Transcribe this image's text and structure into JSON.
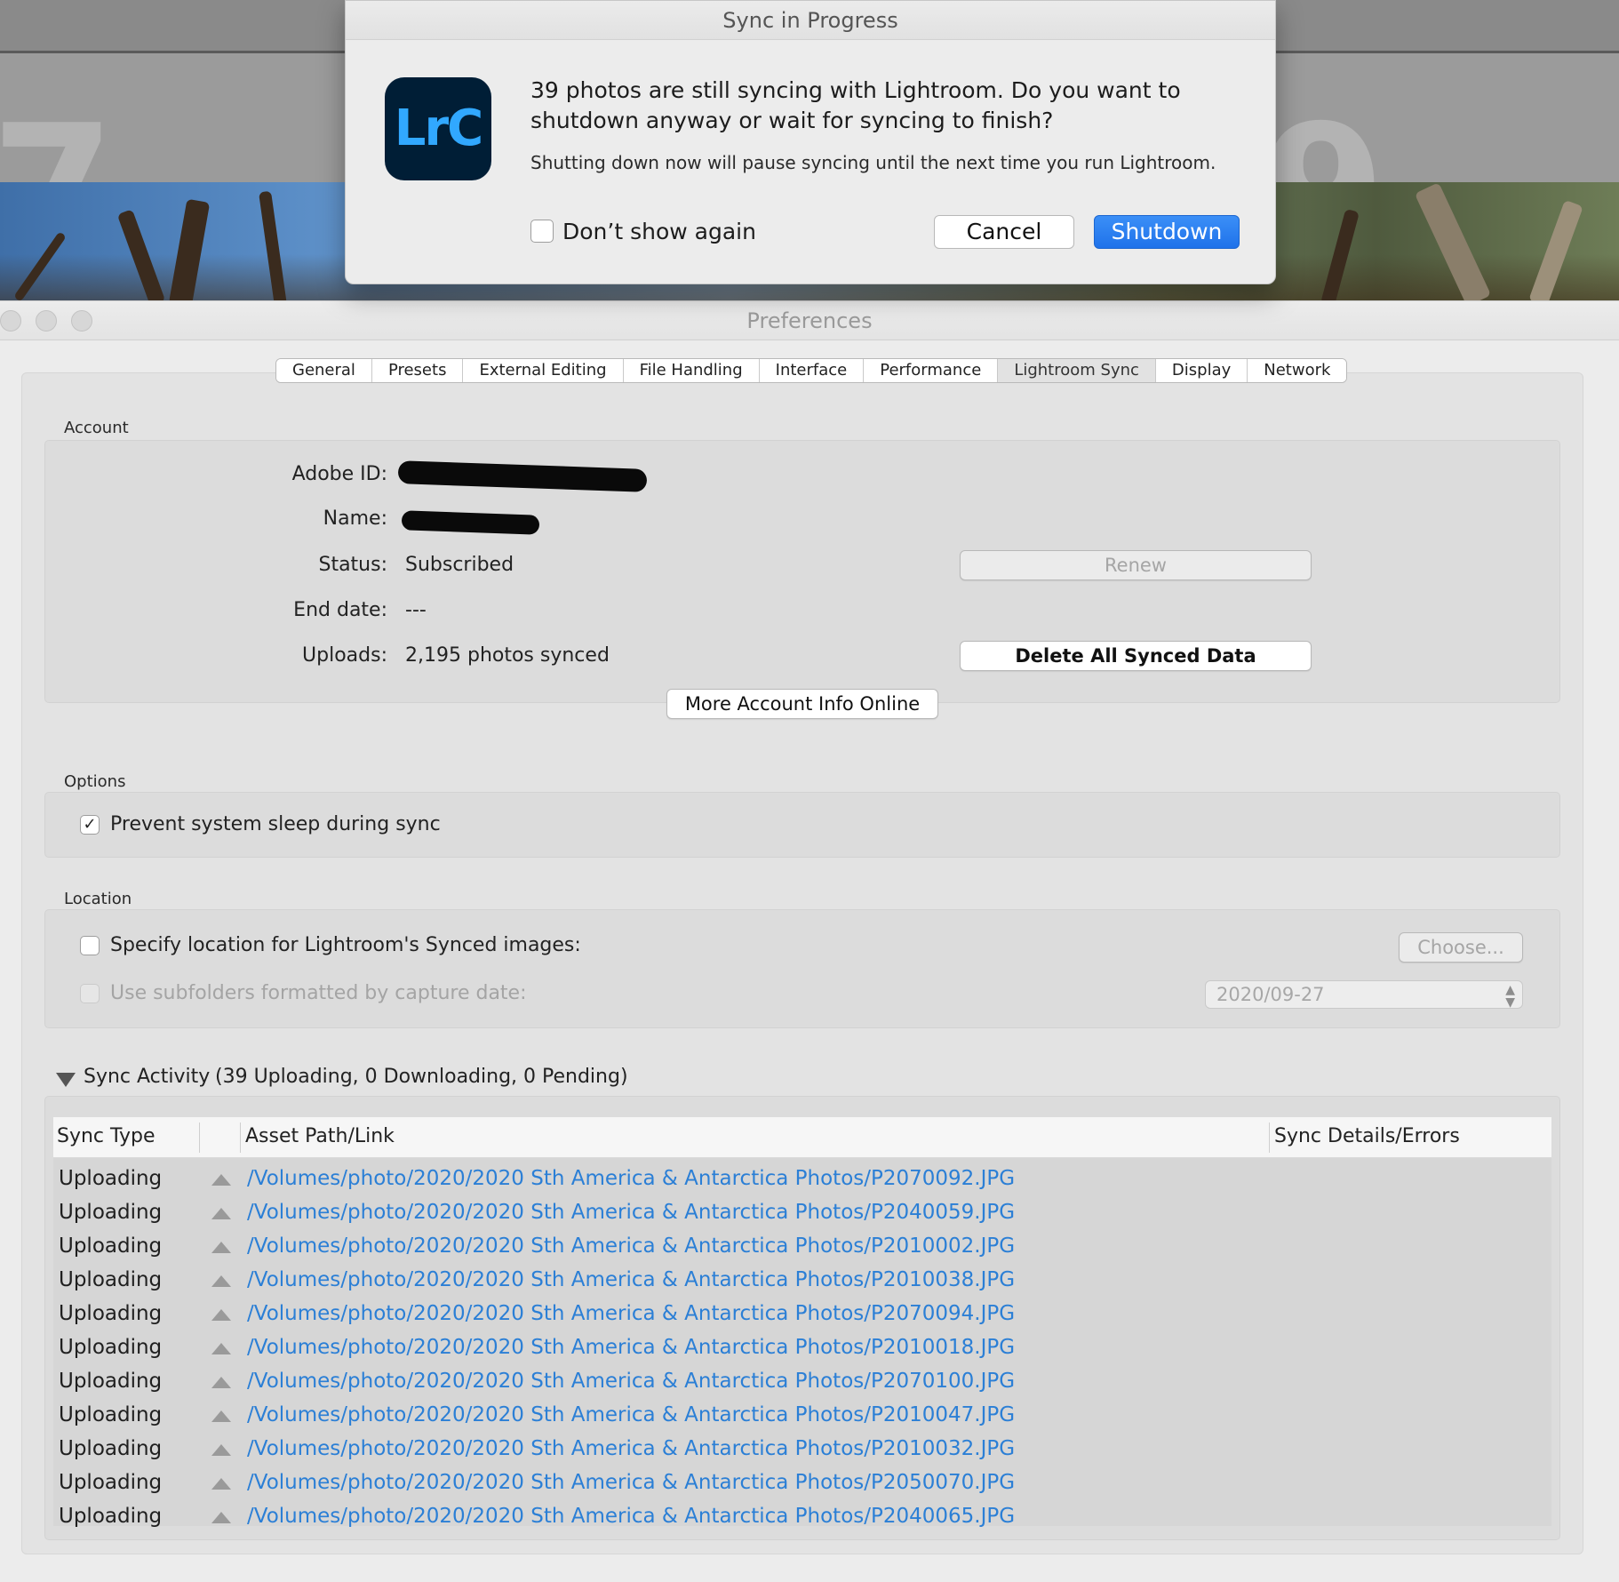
{
  "dialog": {
    "title": "Sync in Progress",
    "app_icon_text": "LrC",
    "message": "39 photos are still syncing with Lightroom. Do you want to shutdown anyway or wait for syncing to finish?",
    "submessage": "Shutting down now will pause syncing until the next time you run Lightroom.",
    "dont_show_label": "Don’t show again",
    "cancel_label": "Cancel",
    "shutdown_label": "Shutdown"
  },
  "window": {
    "title": "Preferences"
  },
  "tabs": [
    "General",
    "Presets",
    "External Editing",
    "File Handling",
    "Interface",
    "Performance",
    "Lightroom Sync",
    "Display",
    "Network"
  ],
  "active_tab": "Lightroom Sync",
  "account": {
    "section_label": "Account",
    "adobe_id_label": "Adobe ID:",
    "name_label": "Name:",
    "status_label": "Status:",
    "status_value": "Subscribed",
    "end_date_label": "End date:",
    "end_date_value": "---",
    "uploads_label": "Uploads:",
    "uploads_value": "2,195 photos synced",
    "renew_label": "Renew",
    "delete_label": "Delete All Synced Data",
    "more_info_label": "More Account Info Online"
  },
  "options": {
    "section_label": "Options",
    "prevent_sleep_label": "Prevent system sleep during sync",
    "prevent_sleep_checked": true,
    "check_glyph": "✓"
  },
  "location": {
    "section_label": "Location",
    "specify_label": "Specify location for Lightroom's Synced images:",
    "choose_label": "Choose...",
    "subfolders_label": "Use subfolders formatted by capture date:",
    "date_format_value": "2020/09-27",
    "select_arrows": "⌃⌄"
  },
  "sync_activity": {
    "title": "Sync Activity",
    "counts": "(39 Uploading, 0 Downloading, 0 Pending)",
    "columns": [
      "Sync Type",
      "Asset Path/Link",
      "Sync Details/Errors"
    ],
    "rows": [
      {
        "type": "Uploading",
        "path": "/Volumes/photo/2020/2020 Sth America & Antarctica Photos/P2070092.JPG"
      },
      {
        "type": "Uploading",
        "path": "/Volumes/photo/2020/2020 Sth America & Antarctica Photos/P2040059.JPG"
      },
      {
        "type": "Uploading",
        "path": "/Volumes/photo/2020/2020 Sth America & Antarctica Photos/P2010002.JPG"
      },
      {
        "type": "Uploading",
        "path": "/Volumes/photo/2020/2020 Sth America & Antarctica Photos/P2010038.JPG"
      },
      {
        "type": "Uploading",
        "path": "/Volumes/photo/2020/2020 Sth America & Antarctica Photos/P2070094.JPG"
      },
      {
        "type": "Uploading",
        "path": "/Volumes/photo/2020/2020 Sth America & Antarctica Photos/P2010018.JPG"
      },
      {
        "type": "Uploading",
        "path": "/Volumes/photo/2020/2020 Sth America & Antarctica Photos/P2070100.JPG"
      },
      {
        "type": "Uploading",
        "path": "/Volumes/photo/2020/2020 Sth America & Antarctica Photos/P2010047.JPG"
      },
      {
        "type": "Uploading",
        "path": "/Volumes/photo/2020/2020 Sth America & Antarctica Photos/P2010032.JPG"
      },
      {
        "type": "Uploading",
        "path": "/Volumes/photo/2020/2020 Sth America & Antarctica Photos/P2050070.JPG"
      },
      {
        "type": "Uploading",
        "path": "/Volumes/photo/2020/2020 Sth America & Antarctica Photos/P2040065.JPG"
      }
    ]
  },
  "colors": {
    "accent_blue": "#1f72ea",
    "link_blue": "#2b7fd6",
    "lrc_icon_bg": "#001e36",
    "lrc_icon_fg": "#31a8ff"
  },
  "background": {
    "glyph_left": "7",
    "glyph_right": "9"
  }
}
